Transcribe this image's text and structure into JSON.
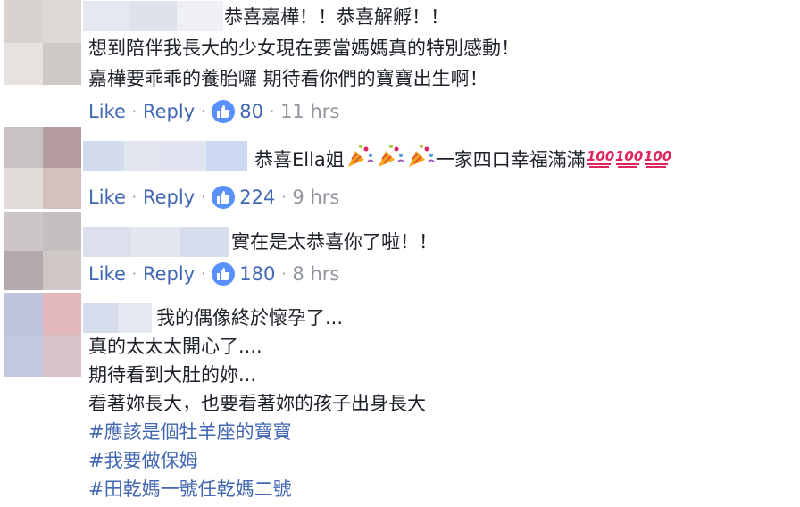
{
  "comments": [
    {
      "lines": [
        "恭喜嘉樺！！恭喜解孵！！",
        "想到陪伴我長大的少女現在要當媽媽真的特別感動！",
        "嘉樺要乖乖的養胎囉 期待看你們的寶寶出生啊！"
      ],
      "like_label": "Like",
      "reply_label": "Reply",
      "like_count": "80",
      "time": "11 hrs"
    },
    {
      "text_before": "恭喜Ella姐",
      "text_middle": "一家四口幸福滿滿",
      "emoji_party": "party-popper-icon",
      "emoji_hundred": "hundred-points-icon",
      "like_label": "Like",
      "reply_label": "Reply",
      "like_count": "224",
      "time": "9 hrs"
    },
    {
      "lines": [
        "實在是太恭喜你了啦！！"
      ],
      "like_label": "Like",
      "reply_label": "Reply",
      "like_count": "180",
      "time": "8 hrs"
    },
    {
      "lines": [
        "我的偶像終於懷孕了...",
        "真的太太太開心了....",
        "期待看到大肚的妳...",
        "看著妳長大，也要看著妳的孩子出身長大"
      ],
      "hashtags": [
        "#應該是個牡羊座的寶寶",
        "#我要做保姆",
        "#田乾媽一號任乾媽二號"
      ]
    }
  ],
  "colors": {
    "link": "#4267b2",
    "meta": "#90949c",
    "text": "#1d2129",
    "like_badge": "#5890ff"
  }
}
